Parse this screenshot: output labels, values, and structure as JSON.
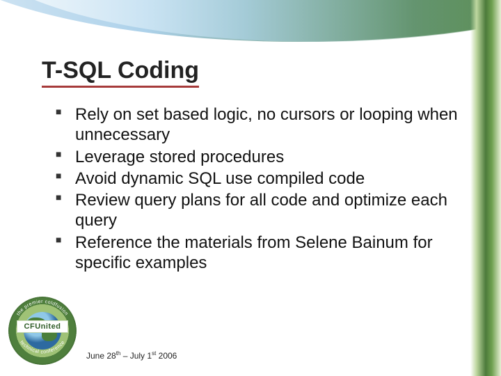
{
  "slide": {
    "title": "T-SQL Coding",
    "bullets": [
      "Rely on set based logic, no cursors or looping when unnecessary",
      "Leverage stored procedures",
      "Avoid dynamic SQL use compiled code",
      "Review query plans for all code and optimize each query",
      "Reference the materials from Selene Bainum for specific examples"
    ]
  },
  "footer": {
    "date_prefix": "June 28",
    "date_sup1": "th",
    "date_mid": " – July 1",
    "date_sup2": "st",
    "date_suffix": " 2006"
  },
  "logo": {
    "banner": "CFUnited",
    "ring_top": "the premier coldfusion",
    "ring_bottom": "technical conference"
  }
}
